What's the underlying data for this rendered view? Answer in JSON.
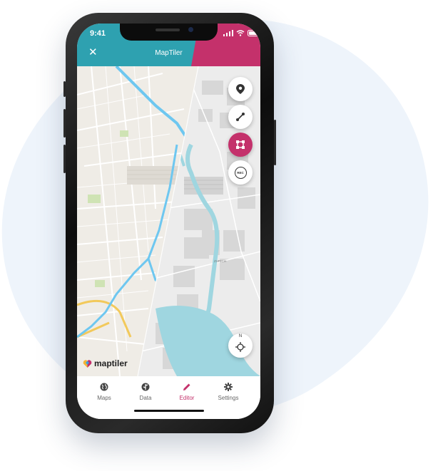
{
  "status_bar": {
    "time": "9:41"
  },
  "header": {
    "title": "MapTiler",
    "close_icon": "close-icon"
  },
  "map": {
    "city_label": "ZURICH",
    "compass_label": "N"
  },
  "tools": [
    {
      "name": "marker",
      "icon": "map-pin-icon",
      "active": false
    },
    {
      "name": "line",
      "icon": "line-draw-icon",
      "active": false
    },
    {
      "name": "polygon",
      "icon": "polygon-draw-icon",
      "active": true
    },
    {
      "name": "record",
      "icon": "rec-icon",
      "label": "REC",
      "active": false
    }
  ],
  "logo": {
    "text": "maptiler"
  },
  "tabs": [
    {
      "label": "Maps",
      "icon": "globe-icon",
      "active": false
    },
    {
      "label": "Data",
      "icon": "data-icon",
      "active": false
    },
    {
      "label": "Editor",
      "icon": "pencil-icon",
      "active": true
    },
    {
      "label": "Settings",
      "icon": "gear-icon",
      "active": false
    }
  ],
  "colors": {
    "accent": "#c4316b",
    "header_teal": "#2ea1b0",
    "river": "#6ec7f0",
    "lake": "#9fd6e0"
  }
}
